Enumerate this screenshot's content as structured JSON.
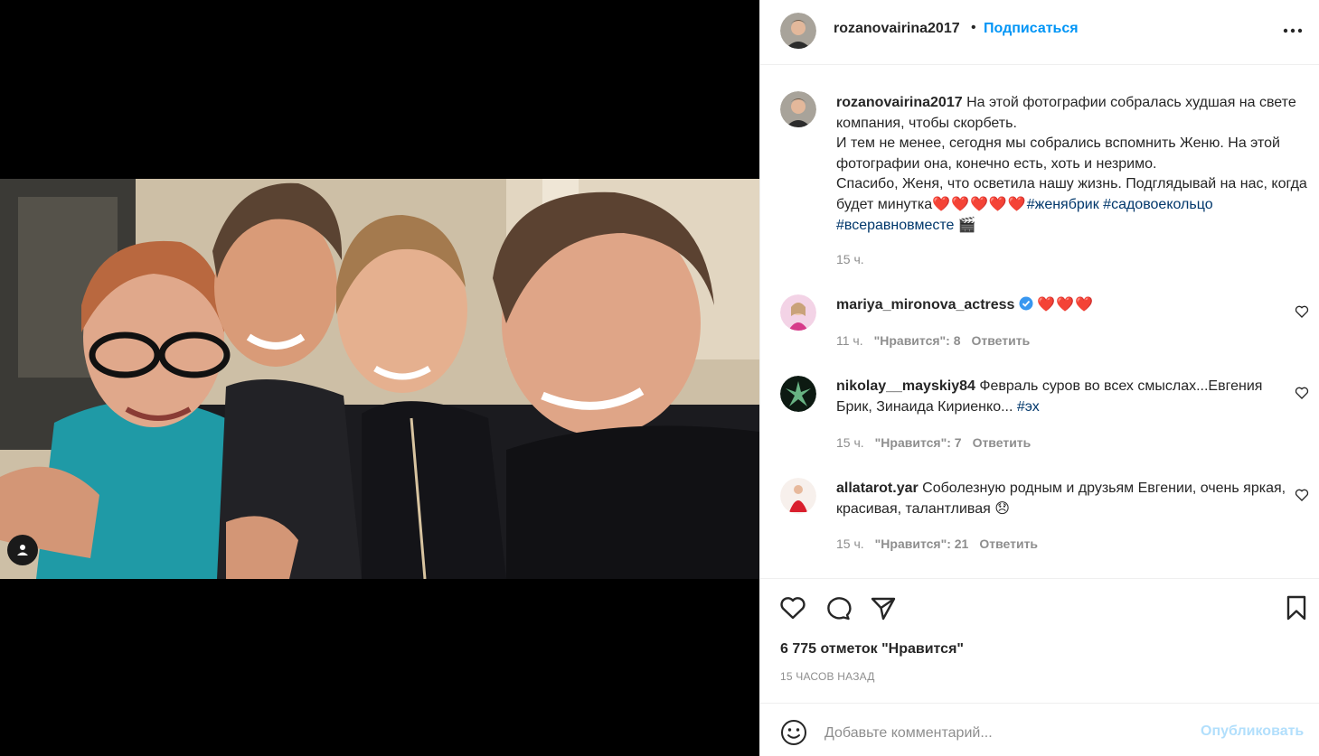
{
  "post": {
    "author": "rozanovairina2017",
    "dot": "•",
    "follow_label": "Подписаться",
    "more_icon": "more-horizontal-icon",
    "tag_icon": "user-tag-icon"
  },
  "caption": {
    "username": "rozanovairina2017",
    "text": "На этой фотографии собралась худшая на свете компания, чтобы скорбеть.",
    "text2": "И тем не менее, сегодня мы собрались вспомнить Женю. На этой фотографии она, конечно есть, хоть и незримо.",
    "text3": "Спасибо, Женя, что осветила нашу жизнь. Подглядывай на нас, когда будет минутка",
    "hearts": "❤️❤️❤️❤️❤️",
    "hashtags": [
      "#женябрик",
      "#садовоекольцо",
      "#всеравновместе"
    ],
    "emoji": "🎬",
    "time": "15 ч."
  },
  "comments": [
    {
      "username": "mariya_mironova_actress",
      "verified": true,
      "text": "❤️❤️❤️",
      "time": "11 ч.",
      "likes": "\"Нравится\": 8",
      "reply": "Ответить"
    },
    {
      "username": "nikolay__mayskiy84",
      "text": "Февраль суров во всех смыслах...Евгения Брик, Зинаида Кириенко...",
      "hashtag": "#эх",
      "time": "15 ч.",
      "likes": "\"Нравится\": 7",
      "reply": "Ответить"
    },
    {
      "username": "allatarot.yar",
      "text": "Соболезную родным и друзьям Евгении, очень яркая, красивая, талантливая",
      "emoji": "😞",
      "time": "15 ч.",
      "likes": "\"Нравится\": 21",
      "reply": "Ответить"
    }
  ],
  "actions": {
    "like_icon": "heart-icon",
    "comment_icon": "comment-icon",
    "share_icon": "send-icon",
    "save_icon": "bookmark-icon",
    "likes_count": "6 775 отметок \"Нравится\"",
    "time_ago": "15 ЧАСОВ НАЗАД"
  },
  "add_comment": {
    "emoji_icon": "smile-icon",
    "placeholder": "Добавьте комментарий...",
    "publish_label": "Опубликовать"
  },
  "colors": {
    "link_blue": "#0095f6",
    "hashtag": "#00376b",
    "muted": "#8e8e8e",
    "publish_disabled": "#b2dffc"
  }
}
